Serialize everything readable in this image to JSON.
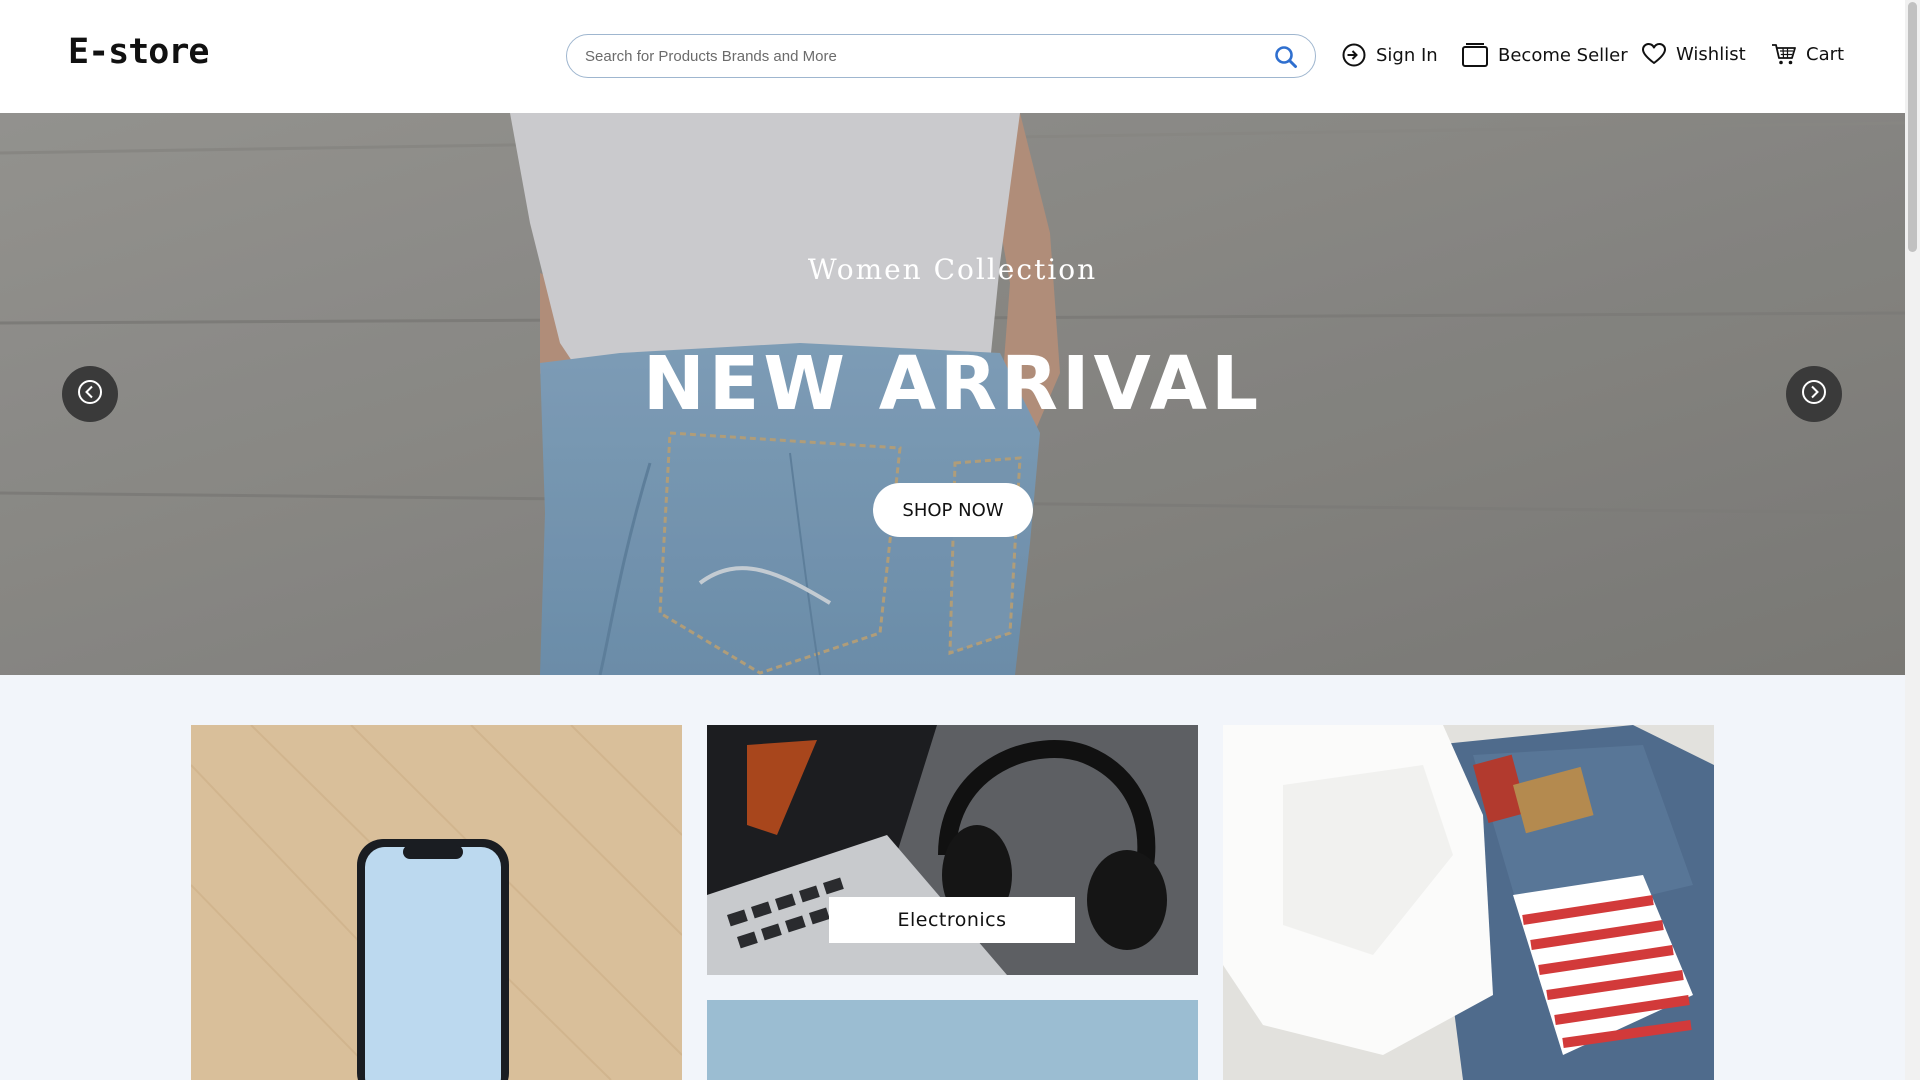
{
  "header": {
    "logo": "E-store",
    "search_placeholder": "Search for Products Brands and More",
    "nav": {
      "sign_in": "Sign In",
      "become_seller": "Become Seller",
      "wishlist": "Wishlist",
      "cart": "Cart"
    }
  },
  "hero": {
    "subtitle": "Women Collection",
    "title": "NEW ARRIVAL",
    "button": "SHOP NOW"
  },
  "categories": [
    {
      "label": ""
    },
    {
      "label": "Electronics"
    },
    {
      "label": ""
    },
    {
      "label": ""
    }
  ],
  "colors": {
    "header_bg": "#ffffff",
    "page_bg": "#f2f5fa",
    "search_icon": "#2f6fcf",
    "arrow_bg": "#3a3a3a"
  },
  "icons": {
    "search": "search-icon",
    "sign_in": "sign-in-icon",
    "seller": "store-icon",
    "wishlist": "heart-icon",
    "cart": "cart-icon",
    "prev": "chevron-left-icon",
    "next": "chevron-right-icon"
  }
}
